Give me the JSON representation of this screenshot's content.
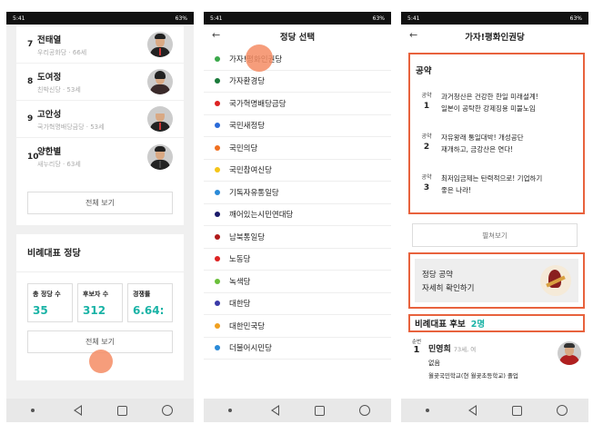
{
  "status": {
    "time": "5:41",
    "battery": "63%"
  },
  "screen1": {
    "candidates": [
      {
        "num": "7",
        "name": "전태열",
        "meta": "우리공화당 · 66세"
      },
      {
        "num": "8",
        "name": "도여정",
        "meta": "친박신당 · 53세"
      },
      {
        "num": "9",
        "name": "고안성",
        "meta": "국가혁명배당금당 · 53세"
      },
      {
        "num": "10",
        "name": "양한별",
        "meta": "새누리당 · 63세"
      }
    ],
    "view_all": "전체 보기",
    "pr_title": "비례대표 정당",
    "stats": [
      {
        "label": "총 정당 수",
        "value": "35"
      },
      {
        "label": "후보자 수",
        "value": "312"
      },
      {
        "label": "경쟁률",
        "value": "6.64:"
      }
    ],
    "view_all_2": "전체 보기"
  },
  "screen2": {
    "title": "정당 선택",
    "parties": [
      {
        "name": "가자!평화인권당",
        "color": "#3aa84a"
      },
      {
        "name": "가자환경당",
        "color": "#1a7a3a"
      },
      {
        "name": "국가혁명배당금당",
        "color": "#d22"
      },
      {
        "name": "국민새정당",
        "color": "#2a6ad8"
      },
      {
        "name": "국민의당",
        "color": "#f07020"
      },
      {
        "name": "국민참여신당",
        "color": "#f5c518"
      },
      {
        "name": "기독자유통일당",
        "color": "#2a8ad8"
      },
      {
        "name": "깨어있는시민연대당",
        "color": "#1a1a6a"
      },
      {
        "name": "남북통일당",
        "color": "#b01a1a"
      },
      {
        "name": "노동당",
        "color": "#d22"
      },
      {
        "name": "녹색당",
        "color": "#6abf3a"
      },
      {
        "name": "대한당",
        "color": "#3a3aa8"
      },
      {
        "name": "대한민국당",
        "color": "#f0a020"
      },
      {
        "name": "더불어시민당",
        "color": "#2a8ad8"
      }
    ]
  },
  "screen3": {
    "title": "가자!평화인권당",
    "pledge_title": "공약",
    "pledges": [
      {
        "label": "공약",
        "num": "1",
        "lines": [
          "과거청산은 건강한 한일 미래설계!",
          "일본이 공탁한 강제징용 미불노임"
        ]
      },
      {
        "label": "공약",
        "num": "2",
        "lines": [
          "자유왕래 통일대박! 개성공단",
          "재개하고, 금강산은 연다!"
        ]
      },
      {
        "label": "공약",
        "num": "3",
        "lines": [
          "최저임금제는 탄력적으로! 기업하기",
          "좋은 나라!"
        ]
      }
    ],
    "expand": "펼쳐보기",
    "banner_line1": "정당 공약",
    "banner_line2": "자세히 확인하기",
    "pr_candidates_title": "비례대표 후보",
    "pr_candidates_count": "2명",
    "candidate": {
      "order_label": "순번",
      "order": "1",
      "name": "민영희",
      "age": "73세, 여",
      "line1": "없음",
      "line2": "월곶국민학교(현 월곶초등학교) 졸업"
    }
  }
}
